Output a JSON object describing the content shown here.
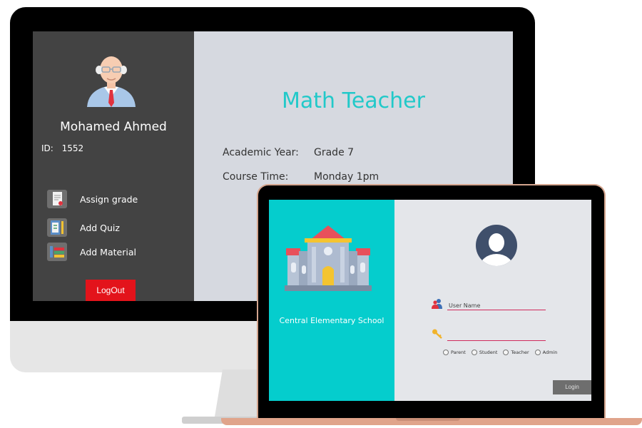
{
  "teacher_dashboard": {
    "teacher_name": "Mohamed Ahmed",
    "id_label": "ID:",
    "id_value": "1552",
    "menu": [
      {
        "label": "Assign grade",
        "icon": "document-icon"
      },
      {
        "label": "Add Quiz",
        "icon": "clipboard-icon"
      },
      {
        "label": "Add Material",
        "icon": "books-icon"
      }
    ],
    "logout_label": "LogOut",
    "role_title": "Math Teacher",
    "academic_year_label": "Academic Year:",
    "academic_year_value": "Grade 7",
    "course_time_label": "Course Time:",
    "course_time_value": "Monday 1pm"
  },
  "login": {
    "school_name": "Central Elementary School",
    "username_placeholder": "User Name",
    "password_placeholder": "",
    "roles": [
      "Parent",
      "Student",
      "Teacher",
      "Admin"
    ],
    "login_label": "Login"
  },
  "colors": {
    "sidebar": "#434343",
    "accent_teal": "#22c9c9",
    "login_panel": "#05cdcd",
    "logout": "#e3131b",
    "field_underline": "#d02a5c"
  }
}
